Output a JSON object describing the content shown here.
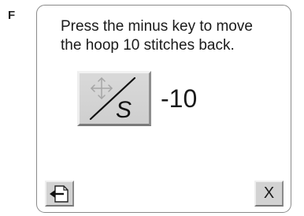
{
  "section_letter": "F",
  "instruction": "Press the minus key to move\nthe hoop 10 stitches back.",
  "key": {
    "icon": "move-hoop-stitch-icon",
    "glyph": "S"
  },
  "value_label": "-10",
  "buttons": {
    "back_icon": "back-arrow-icon",
    "close_label": "X"
  }
}
